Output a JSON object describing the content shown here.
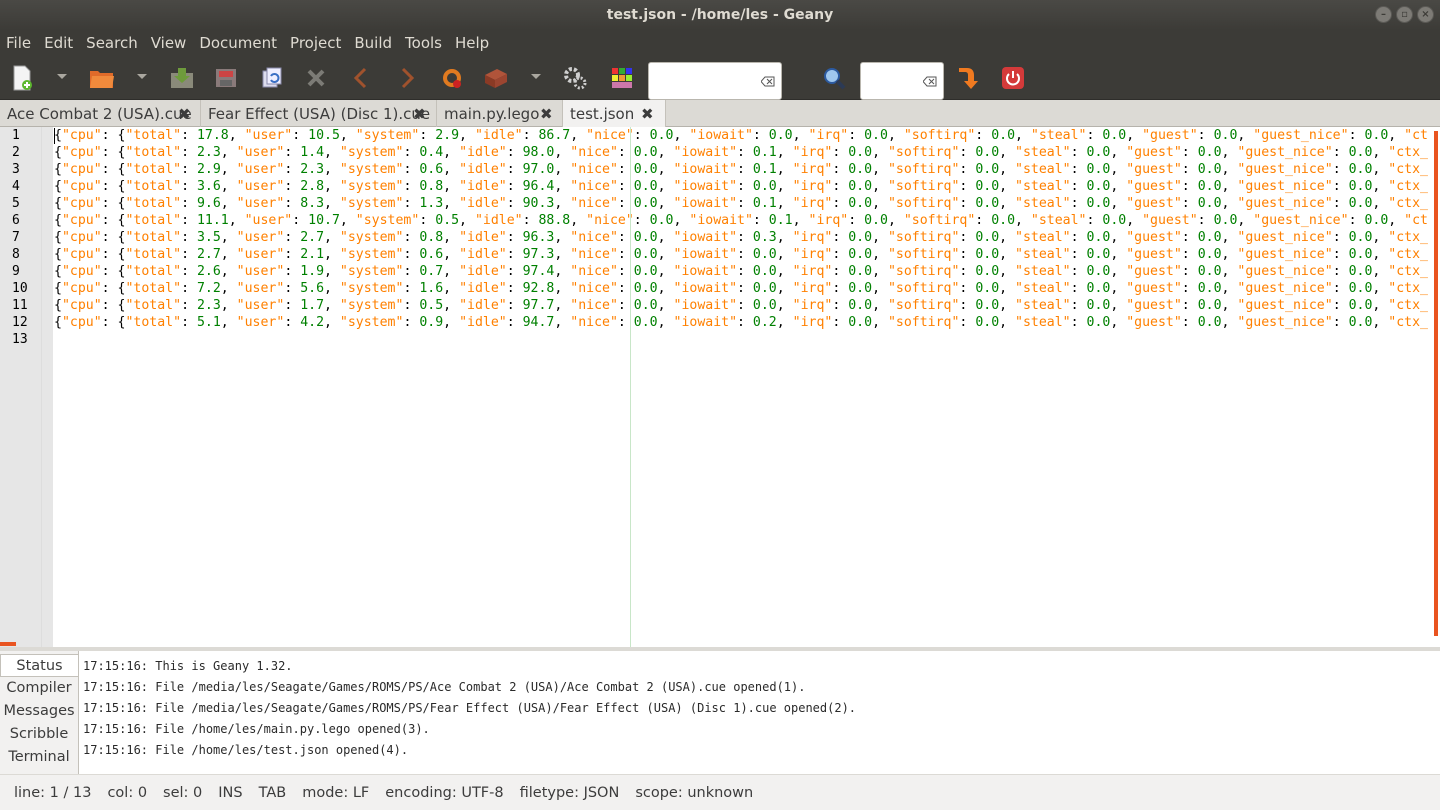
{
  "window": {
    "title": "test.json - /home/les - Geany",
    "controls": [
      "minimize-icon",
      "maximize-icon",
      "close-icon"
    ]
  },
  "menu": [
    "File",
    "Edit",
    "Search",
    "View",
    "Document",
    "Project",
    "Build",
    "Tools",
    "Help"
  ],
  "toolbar": {
    "icons": [
      "new-file-icon",
      "open-file-icon",
      "save-icon",
      "save-all-icon",
      "revert-icon",
      "close-file-icon",
      "back-icon",
      "forward-icon",
      "compile-icon",
      "build-icon",
      "execute-icon",
      "preferences-icon",
      "color-chooser-icon",
      "search-icon",
      "goto-line-icon",
      "quit-icon"
    ],
    "search_value": "",
    "goto_value": ""
  },
  "tabs": [
    {
      "label": "Ace Combat 2 (USA).cue",
      "active": false
    },
    {
      "label": "Fear Effect (USA) (Disc 1).cue",
      "active": false
    },
    {
      "label": "main.py.lego",
      "active": false
    },
    {
      "label": "test.json",
      "active": true
    }
  ],
  "editor": {
    "line_numbers": [
      "1",
      "2",
      "3",
      "4",
      "5",
      "6",
      "7",
      "8",
      "9",
      "10",
      "11",
      "12",
      "13"
    ],
    "rows": [
      {
        "total": "17.8",
        "user": "10.5",
        "system": "2.9",
        "idle": "86.7",
        "nice": "0.0",
        "iowait": "0.0",
        "irq": "0.0",
        "softirq": "0.0",
        "steal": "0.0",
        "guest": "0.0",
        "guest_nice": "0.0",
        "tail": "\"ct"
      },
      {
        "total": "2.3",
        "user": "1.4",
        "system": "0.4",
        "idle": "98.0",
        "nice": "0.0",
        "iowait": "0.1",
        "irq": "0.0",
        "softirq": "0.0",
        "steal": "0.0",
        "guest": "0.0",
        "guest_nice": "0.0",
        "tail": "\"ctx_"
      },
      {
        "total": "2.9",
        "user": "2.3",
        "system": "0.6",
        "idle": "97.0",
        "nice": "0.0",
        "iowait": "0.1",
        "irq": "0.0",
        "softirq": "0.0",
        "steal": "0.0",
        "guest": "0.0",
        "guest_nice": "0.0",
        "tail": "\"ctx_"
      },
      {
        "total": "3.6",
        "user": "2.8",
        "system": "0.8",
        "idle": "96.4",
        "nice": "0.0",
        "iowait": "0.0",
        "irq": "0.0",
        "softirq": "0.0",
        "steal": "0.0",
        "guest": "0.0",
        "guest_nice": "0.0",
        "tail": "\"ctx_"
      },
      {
        "total": "9.6",
        "user": "8.3",
        "system": "1.3",
        "idle": "90.3",
        "nice": "0.0",
        "iowait": "0.1",
        "irq": "0.0",
        "softirq": "0.0",
        "steal": "0.0",
        "guest": "0.0",
        "guest_nice": "0.0",
        "tail": "\"ctx_"
      },
      {
        "total": "11.1",
        "user": "10.7",
        "system": "0.5",
        "idle": "88.8",
        "nice": "0.0",
        "iowait": "0.1",
        "irq": "0.0",
        "softirq": "0.0",
        "steal": "0.0",
        "guest": "0.0",
        "guest_nice": "0.0",
        "tail": "\"ct"
      },
      {
        "total": "3.5",
        "user": "2.7",
        "system": "0.8",
        "idle": "96.3",
        "nice": "0.0",
        "iowait": "0.3",
        "irq": "0.0",
        "softirq": "0.0",
        "steal": "0.0",
        "guest": "0.0",
        "guest_nice": "0.0",
        "tail": "\"ctx_"
      },
      {
        "total": "2.7",
        "user": "2.1",
        "system": "0.6",
        "idle": "97.3",
        "nice": "0.0",
        "iowait": "0.0",
        "irq": "0.0",
        "softirq": "0.0",
        "steal": "0.0",
        "guest": "0.0",
        "guest_nice": "0.0",
        "tail": "\"ctx_"
      },
      {
        "total": "2.6",
        "user": "1.9",
        "system": "0.7",
        "idle": "97.4",
        "nice": "0.0",
        "iowait": "0.0",
        "irq": "0.0",
        "softirq": "0.0",
        "steal": "0.0",
        "guest": "0.0",
        "guest_nice": "0.0",
        "tail": "\"ctx_"
      },
      {
        "total": "7.2",
        "user": "5.6",
        "system": "1.6",
        "idle": "92.8",
        "nice": "0.0",
        "iowait": "0.0",
        "irq": "0.0",
        "softirq": "0.0",
        "steal": "0.0",
        "guest": "0.0",
        "guest_nice": "0.0",
        "tail": "\"ctx_"
      },
      {
        "total": "2.3",
        "user": "1.7",
        "system": "0.5",
        "idle": "97.7",
        "nice": "0.0",
        "iowait": "0.0",
        "irq": "0.0",
        "softirq": "0.0",
        "steal": "0.0",
        "guest": "0.0",
        "guest_nice": "0.0",
        "tail": "\"ctx_"
      },
      {
        "total": "5.1",
        "user": "4.2",
        "system": "0.9",
        "idle": "94.7",
        "nice": "0.0",
        "iowait": "0.2",
        "irq": "0.0",
        "softirq": "0.0",
        "steal": "0.0",
        "guest": "0.0",
        "guest_nice": "0.0",
        "tail": "\"ctx_"
      }
    ],
    "colors": {
      "key": "#ff8000",
      "number": "#008000",
      "punct": "#000000"
    }
  },
  "panel": {
    "tabs": [
      "Status",
      "Compiler",
      "Messages",
      "Scribble",
      "Terminal"
    ],
    "active_tab": "Status",
    "log": [
      "17:15:16: This is Geany 1.32.",
      "17:15:16: File /media/les/Seagate/Games/ROMS/PS/Ace Combat 2 (USA)/Ace Combat 2 (USA).cue opened(1).",
      "17:15:16: File /media/les/Seagate/Games/ROMS/PS/Fear Effect (USA)/Fear Effect (USA) (Disc 1).cue opened(2).",
      "17:15:16: File /home/les/main.py.lego opened(3).",
      "17:15:16: File /home/les/test.json opened(4)."
    ]
  },
  "status": {
    "line": "line: 1 / 13",
    "col": "col: 0",
    "sel": "sel: 0",
    "ins": "INS",
    "tab": "TAB",
    "mode": "mode: LF",
    "encoding": "encoding: UTF-8",
    "filetype": "filetype: JSON",
    "scope": "scope: unknown"
  }
}
